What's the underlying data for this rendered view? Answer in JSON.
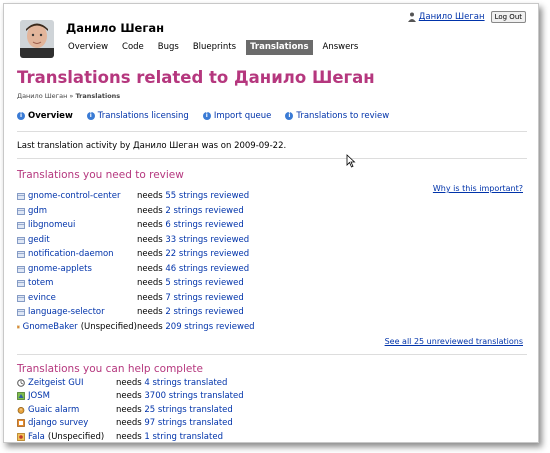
{
  "header": {
    "name": "Данило Шеган",
    "nav": [
      "Overview",
      "Code",
      "Bugs",
      "Blueprints",
      "Translations",
      "Answers"
    ],
    "active_nav": "Translations",
    "user": "Данило Шеган",
    "logout_label": "Log Out"
  },
  "page": {
    "title": "Translations related to Данило Шеган",
    "breadcrumb": [
      "Данило Шеган",
      "Translations"
    ],
    "subnav": [
      "Overview",
      "Translations licensing",
      "Import queue",
      "Translations to review"
    ],
    "activity_text": "Last translation activity by Данило Шеган was on 2009-09-22."
  },
  "review": {
    "heading": "Translations you need to review",
    "why_link": "Why is this important?",
    "items": [
      {
        "name": "gnome-control-center",
        "extra": "",
        "needs": "needs",
        "count": "55 strings reviewed"
      },
      {
        "name": "gdm",
        "extra": "",
        "needs": "needs",
        "count": "2 strings reviewed"
      },
      {
        "name": "libgnomeui",
        "extra": "",
        "needs": "needs",
        "count": "6 strings reviewed"
      },
      {
        "name": "gedit",
        "extra": "",
        "needs": "needs",
        "count": "33 strings reviewed"
      },
      {
        "name": "notification-daemon",
        "extra": "",
        "needs": "needs",
        "count": "22 strings reviewed"
      },
      {
        "name": "gnome-applets",
        "extra": "",
        "needs": "needs",
        "count": "46 strings reviewed"
      },
      {
        "name": "totem",
        "extra": "",
        "needs": "needs",
        "count": "5 strings reviewed"
      },
      {
        "name": "evince",
        "extra": "",
        "needs": "needs",
        "count": "7 strings reviewed"
      },
      {
        "name": "language-selector",
        "extra": "",
        "needs": "needs",
        "count": "2 strings reviewed"
      },
      {
        "name": "GnomeBaker",
        "extra": "(Unspecified)",
        "needs": "needs",
        "count": "209 strings reviewed"
      }
    ],
    "see_all": "See all 25 unreviewed translations"
  },
  "complete": {
    "heading": "Translations you can help complete",
    "items": [
      {
        "name": "Zeitgeist GUI",
        "extra": "",
        "needs": "needs",
        "count": "4 strings translated"
      },
      {
        "name": "JOSM",
        "extra": "",
        "needs": "needs",
        "count": "3700 strings translated"
      },
      {
        "name": "Guaic alarm",
        "extra": "",
        "needs": "needs",
        "count": "25 strings translated"
      },
      {
        "name": "django survey",
        "extra": "",
        "needs": "needs",
        "count": "97 strings translated"
      },
      {
        "name": "Fala",
        "extra": "(Unspecified)",
        "needs": "needs",
        "count": "1 string translated"
      }
    ]
  },
  "colors": {
    "accent": "#b5377e",
    "link": "#0033aa",
    "active_tab_bg": "#6b6b6b"
  },
  "icons": {
    "package": "package-icon",
    "info": "info-icon",
    "user": "person-icon",
    "cursor": "mouse-cursor-icon"
  }
}
